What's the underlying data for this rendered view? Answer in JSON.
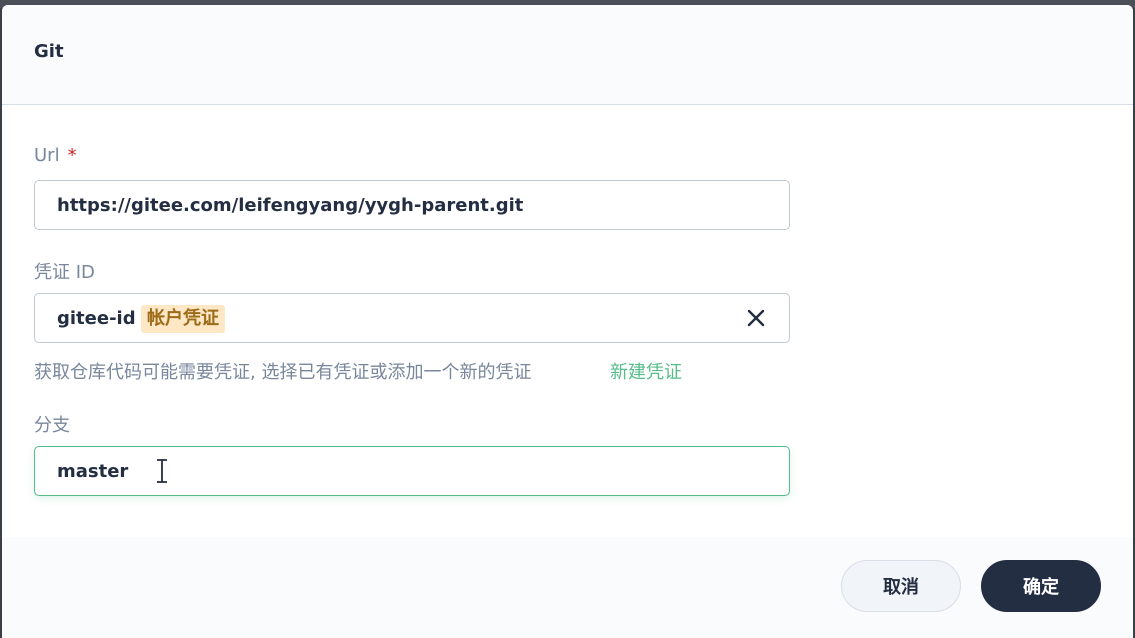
{
  "dialog": {
    "title": "Git"
  },
  "url_field": {
    "label": "Url",
    "required_mark": "*",
    "value": "https://gitee.com/leifengyang/yygh-parent.git"
  },
  "credential_field": {
    "label": "凭证 ID",
    "value": "gitee-id",
    "tag": "帐户凭证",
    "clear_icon": "close-icon",
    "hint": "获取仓库代码可能需要凭证, 选择已有凭证或添加一个新的凭证",
    "link": "新建凭证"
  },
  "branch_field": {
    "label": "分支",
    "value": "master"
  },
  "footer": {
    "cancel_label": "取消",
    "confirm_label": "确定"
  },
  "colors": {
    "accent_green": "#55bc8a",
    "primary_dark": "#242e42",
    "tag_bg": "#fde7c5",
    "tag_text": "#9d6a17",
    "required": "#ca2621"
  }
}
